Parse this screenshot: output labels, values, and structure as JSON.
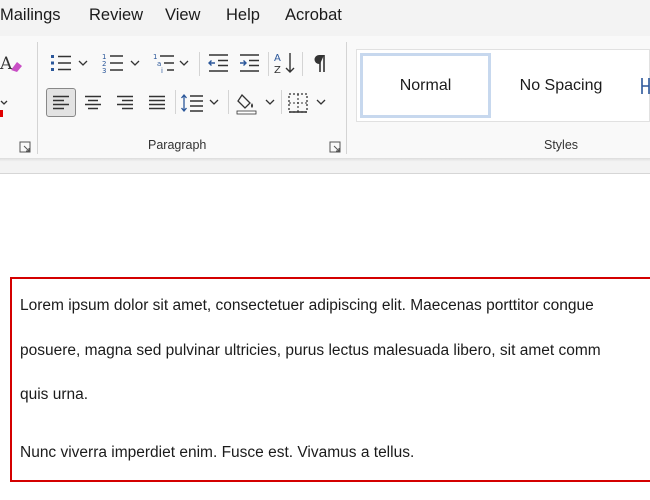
{
  "menu": {
    "items": [
      "Mailings",
      "Review",
      "View",
      "Help",
      "Acrobat"
    ]
  },
  "ribbon": {
    "paragraph_label": "Paragraph",
    "styles_label": "Styles",
    "styles": {
      "normal": "Normal",
      "no_spacing": "No Spacing"
    }
  },
  "document": {
    "lines": [
      "Lorem ipsum dolor sit amet, consectetuer adipiscing elit. Maecenas porttitor congue",
      "posuere, magna sed pulvinar ultricies, purus lectus malesuada libero, sit amet comm",
      "quis urna.",
      "Nunc viverra imperdiet enim. Fusce est. Vivamus a tellus."
    ]
  },
  "colors": {
    "highlight_border": "#d40000",
    "selected_style_border": "#c7d8ee",
    "active_button_border": "#888888",
    "icon_blue": "#2b579a"
  }
}
